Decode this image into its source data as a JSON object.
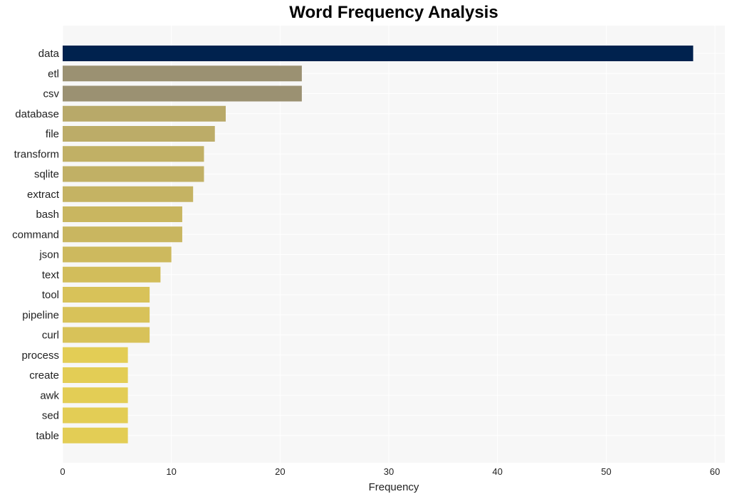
{
  "chart_data": {
    "type": "bar",
    "orientation": "horizontal",
    "title": "Word Frequency Analysis",
    "xlabel": "Frequency",
    "ylabel": "",
    "xlim": [
      0,
      61
    ],
    "xticks": [
      0,
      10,
      20,
      30,
      40,
      50,
      60
    ],
    "grid": true,
    "categories": [
      "data",
      "etl",
      "csv",
      "database",
      "file",
      "transform",
      "sqlite",
      "extract",
      "bash",
      "command",
      "json",
      "text",
      "tool",
      "pipeline",
      "curl",
      "process",
      "create",
      "awk",
      "sed",
      "table"
    ],
    "values": [
      58,
      22,
      22,
      15,
      14,
      13,
      13,
      12,
      11,
      11,
      10,
      9,
      8,
      8,
      8,
      6,
      6,
      6,
      6,
      6
    ],
    "colors": [
      "#00224e",
      "#9b9172",
      "#9b9172",
      "#b8a969",
      "#bcac68",
      "#c1b065",
      "#c1b065",
      "#c5b363",
      "#c9b660",
      "#c9b660",
      "#cdb95e",
      "#d2bd5b",
      "#d8c259",
      "#d8c259",
      "#d8c259",
      "#e3cd55",
      "#e3cd55",
      "#e3cd55",
      "#e3cd55",
      "#e3cd55"
    ]
  }
}
